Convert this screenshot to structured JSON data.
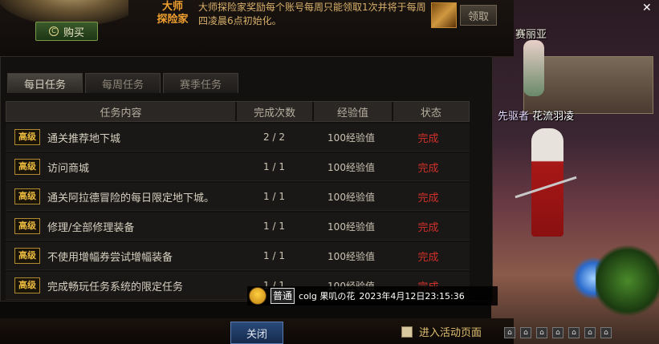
{
  "header": {
    "buy_label": "购买",
    "rank_title_line1": "大师",
    "rank_title_line2": "探险家",
    "rank_description": "大师探险家奖励每个账号每周只能领取1次并将于每周四凌晨6点初始化。",
    "claim_label": "领取"
  },
  "tabs": [
    {
      "label": "每日任务",
      "active": true
    },
    {
      "label": "每周任务",
      "active": false
    },
    {
      "label": "赛季任务",
      "active": false
    }
  ],
  "table": {
    "headers": [
      "任务内容",
      "完成次数",
      "经验值",
      "状态"
    ],
    "rows": [
      {
        "badge": "高级",
        "task": "通关推荐地下城",
        "count": "2 / 2",
        "exp": "100经验值",
        "status": "完成"
      },
      {
        "badge": "高级",
        "task": "访问商城",
        "count": "1 / 1",
        "exp": "100经验值",
        "status": "完成"
      },
      {
        "badge": "高级",
        "task": "通关阿拉德冒险的每日限定地下城。",
        "count": "1 / 1",
        "exp": "100经验值",
        "status": "完成"
      },
      {
        "badge": "高级",
        "task": "修理/全部修理装备",
        "count": "1 / 1",
        "exp": "100经验值",
        "status": "完成"
      },
      {
        "badge": "高级",
        "task": "不使用增幅券尝试增幅装备",
        "count": "1 / 1",
        "exp": "100经验值",
        "status": "完成"
      },
      {
        "badge": "高级",
        "task": "完成畅玩任务系统的限定任务",
        "count": "1 / 1",
        "exp": "100经验值",
        "status": "完成"
      }
    ]
  },
  "footer": {
    "close_label": "关闭",
    "activity_label": "进入活动页面"
  },
  "chat": {
    "channel": "普通",
    "sender": "colg 果叽の花",
    "timestamp": "2023年4月12日23:15:36"
  },
  "scene": {
    "npc1_name": "赛丽亚",
    "npc2_prefix": "先驱者",
    "npc2_name": "花流羽凌"
  },
  "colors": {
    "status_done": "#d0302a",
    "badge_gold": "#e8b840",
    "title_orange": "#f0a030"
  }
}
